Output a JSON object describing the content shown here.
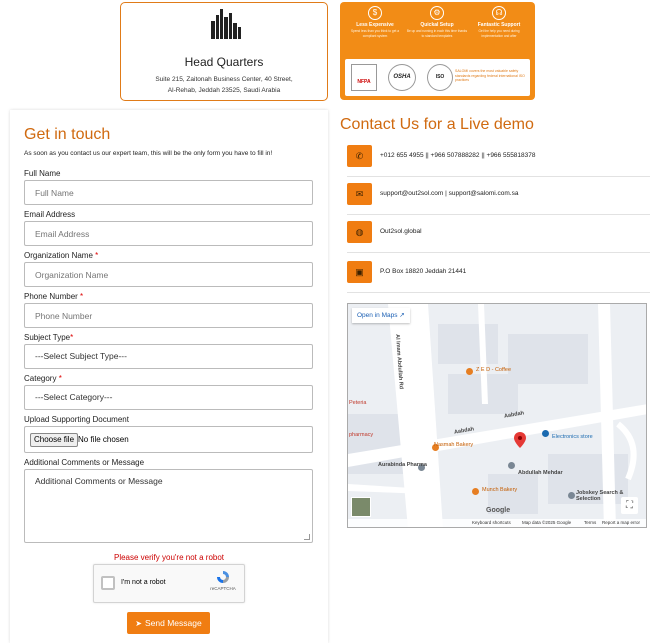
{
  "headquarters": {
    "title": "Head Quarters",
    "address_line1": "Suite 215, Zaitonah Business Center, 40 Street,",
    "address_line2": "Al-Rehab, Jeddah 23525, Saudi Arabia"
  },
  "promo": {
    "features": [
      {
        "icon": "dollar-icon",
        "title": "Less Expensive",
        "desc": "Spend less than you think to get a compliant system"
      },
      {
        "icon": "gear-icon",
        "title": "Quickal Setup",
        "desc": "Be up and running in each this time thanks to standard templates"
      },
      {
        "icon": "headset-icon",
        "title": "Fantastic Support",
        "desc": "Get the help you need during implementation and after"
      }
    ],
    "logos": [
      "NFPA",
      "OSHA",
      "ISO"
    ],
    "logos_text": "SALOMI covers the most valuable safety standards regarding federal international ISO practices"
  },
  "form": {
    "title": "Get in touch",
    "subtitle": "As soon as you contact us our expert team, this will be the only form you have to fill in!",
    "fields": {
      "full_name": {
        "label": "Full Name",
        "placeholder": "Full Name"
      },
      "email": {
        "label": "Email Address",
        "placeholder": "Email Address"
      },
      "organization": {
        "label": "Organization Name",
        "required": "*",
        "placeholder": "Organization Name"
      },
      "phone": {
        "label": "Phone Number",
        "required": "*",
        "placeholder": "Phone Number"
      },
      "subject": {
        "label": "Subject Type",
        "required": "*",
        "selected": "---Select Subject Type---"
      },
      "category": {
        "label": "Category",
        "required": "*",
        "selected": "---Select Category---"
      },
      "upload": {
        "label": "Upload Supporting Document",
        "button": "Choose file",
        "status": "No file chosen"
      },
      "comments": {
        "label": "Additional Comments or Message",
        "placeholder": "Additional Comments or Message"
      }
    },
    "verify_message": "Please verify you're not a robot",
    "recaptcha": {
      "label": "I'm not a robot",
      "brand": "reCAPTCHA"
    },
    "submit_label": "Send Message"
  },
  "contact": {
    "title": "Contact Us for a Live demo",
    "rows": [
      {
        "icon": "phone-icon",
        "text": "+012 655 4955 || +966 507888282 || +966 555818378"
      },
      {
        "icon": "envelope-icon",
        "text": "support@out2sol.com | support@salomi.com.sa"
      },
      {
        "icon": "globe-icon",
        "text": "Out2sol.global"
      },
      {
        "icon": "address-book-icon",
        "text": "P.O Box 18820 Jeddah 21441"
      }
    ]
  },
  "map": {
    "open_label": "Open in Maps",
    "street_labels": [
      "Al Imam Abdullah Rd",
      "Aabdah",
      "Aabdah"
    ],
    "places": [
      {
        "text": "Z E D - Coffee",
        "tone": "or"
      },
      {
        "text": "Nasmah Bakery",
        "tone": "or"
      },
      {
        "text": "Munch Bakery",
        "tone": "or"
      },
      {
        "text": "Abdullah Mehdar",
        "tone": "st"
      },
      {
        "text": "Jobskey Search & Selection",
        "tone": "st"
      },
      {
        "text": "Electronics store",
        "tone": "bl"
      },
      {
        "text": "Aurabinda Pharma",
        "tone": "st"
      },
      {
        "text": "Peteria",
        "tone": "rd"
      },
      {
        "text": "pharmacy",
        "tone": "rd"
      }
    ],
    "footer": {
      "keyboard": "Keyboard shortcuts",
      "data": "Map data ©2025 Google",
      "terms": "Terms",
      "report": "Report a map error"
    },
    "brand": "Google",
    "colors": {
      "road": "#ffffff",
      "block": "#dfe3ea",
      "water": "#cfd6df",
      "pin": "#e53935"
    }
  },
  "colors": {
    "accent": "#f07d12",
    "title": "#d06a10",
    "error": "#cc0000"
  }
}
